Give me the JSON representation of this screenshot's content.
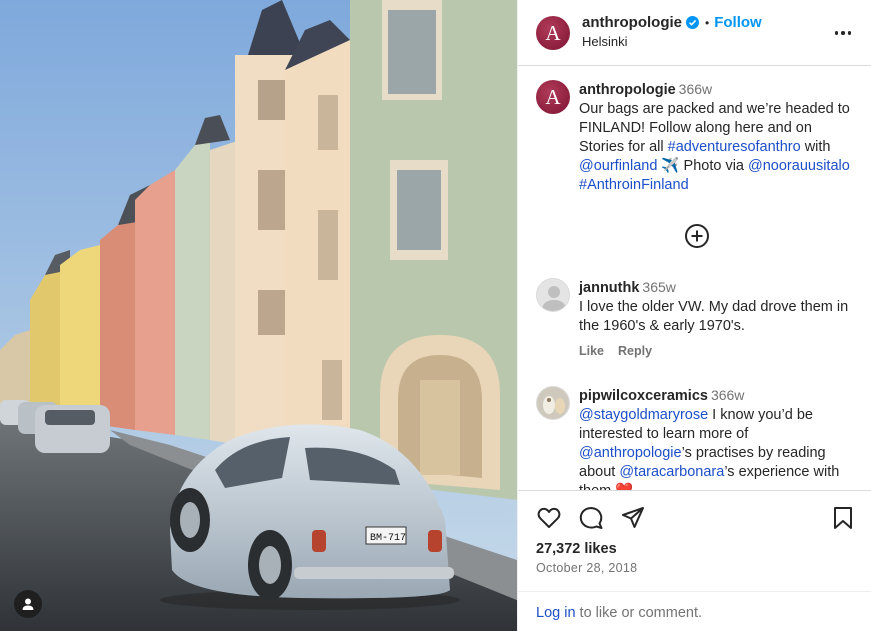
{
  "photo": {
    "plate_text": "BM-717"
  },
  "header": {
    "username": "anthropologie",
    "avatar_letter": "A",
    "separator": "•",
    "follow_label": "Follow",
    "location": "Helsinki"
  },
  "caption": {
    "username": "anthropologie",
    "time": "366w",
    "text_1": "Our bags are packed and we’re headed to FINLAND! Follow along here and on Stories for all ",
    "hashtag_1": "#adventuresofanthro",
    "text_2": " with ",
    "mention_1": "@ourfinland",
    "text_3": " ✈️ Photo via ",
    "mention_2": "@noorauusitalo",
    "text_4": " ",
    "hashtag_2": "#AnthroinFinland"
  },
  "comments": [
    {
      "username": "jannuthk",
      "time": "365w",
      "text": "I love the older VW. My dad drove them in the 1960's & early 1970's.",
      "like_label": "Like",
      "reply_label": "Reply"
    },
    {
      "username": "pipwilcoxceramics",
      "time": "366w",
      "mention_1": "@staygoldmaryrose",
      "text_1": " I know you’d be interested to learn more of ",
      "mention_2": "@anthropologie",
      "text_2": "’s practises by reading about ",
      "mention_3": "@taracarbonara",
      "text_3": "’s experience with them ❤️"
    }
  ],
  "footer": {
    "likes": "27,372 likes",
    "date": "October 28, 2018",
    "login_link": "Log in",
    "login_text": " to like or comment."
  },
  "colors": {
    "accent": "#0095f6",
    "link": "#1d4fc8",
    "brand_avatar": "#8f1d3d",
    "muted": "#737373"
  },
  "icons": [
    "verified-icon",
    "more-options-icon",
    "plus-circle-icon",
    "heart-icon",
    "comment-icon",
    "share-icon",
    "bookmark-icon",
    "user-tag-icon"
  ]
}
